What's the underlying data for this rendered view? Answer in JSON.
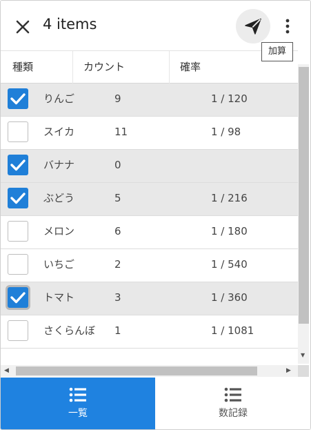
{
  "header": {
    "title": "4 items",
    "tooltip": "加算"
  },
  "table": {
    "columns": [
      "種類",
      "カウント",
      "確率"
    ],
    "rows": [
      {
        "checked": true,
        "name": "りんご",
        "count": "9",
        "probability": "1 / 120"
      },
      {
        "checked": false,
        "name": "スイカ",
        "count": "11",
        "probability": "1 / 98"
      },
      {
        "checked": true,
        "name": "バナナ",
        "count": "0",
        "probability": ""
      },
      {
        "checked": true,
        "name": "ぶどう",
        "count": "5",
        "probability": "1 / 216"
      },
      {
        "checked": false,
        "name": "メロン",
        "count": "6",
        "probability": "1 / 180"
      },
      {
        "checked": false,
        "name": "いちご",
        "count": "2",
        "probability": "1 / 540"
      },
      {
        "checked": true,
        "name": "トマト",
        "count": "3",
        "probability": "1 / 360"
      },
      {
        "checked": false,
        "name": "さくらんぼ",
        "count": "1",
        "probability": "1 / 1081"
      }
    ]
  },
  "bottom_nav": {
    "tabs": [
      {
        "label": "一覧",
        "icon": "list-icon",
        "active": true
      },
      {
        "label": "数記録",
        "icon": "list-icon",
        "active": false
      }
    ]
  },
  "colors": {
    "accent": "#1f82e0",
    "checkbox": "#1f7fd8",
    "checked_row": "#e8e8e8"
  }
}
